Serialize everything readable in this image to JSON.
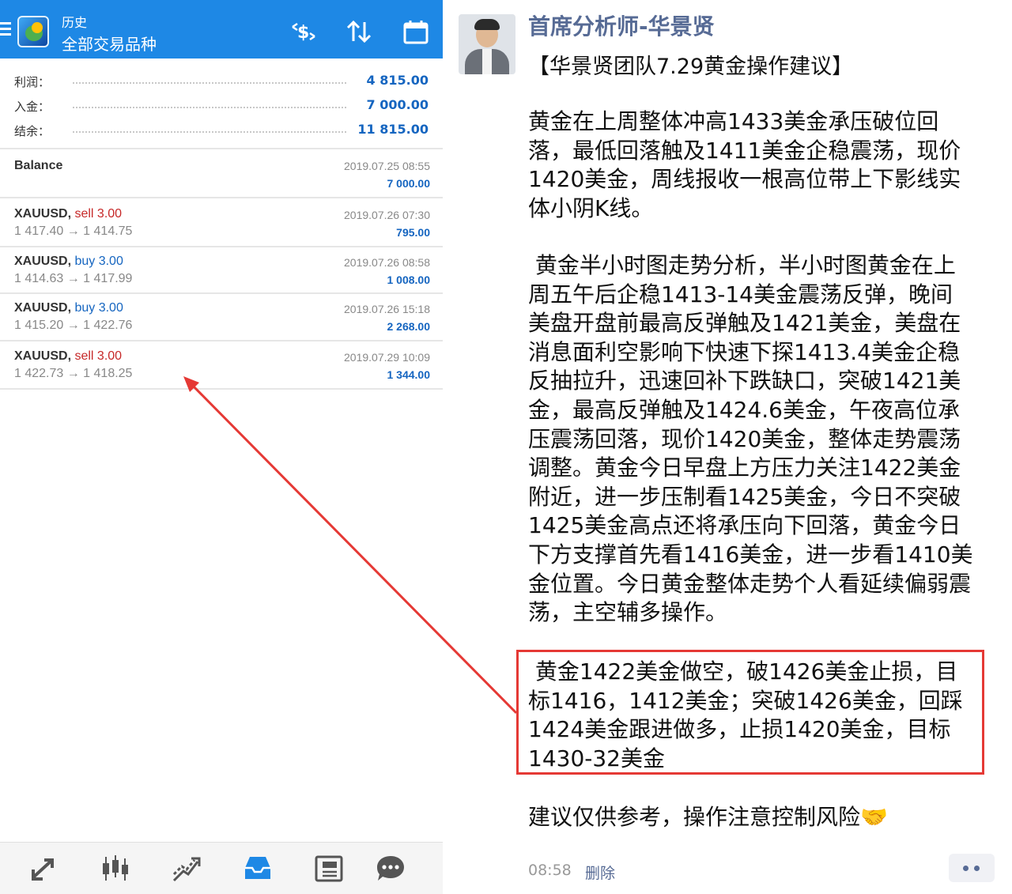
{
  "header": {
    "subtitle": "历史",
    "title": "全部交易品种",
    "icons": [
      "menu-icon",
      "metatrader-logo",
      "dollar-exchange-icon",
      "sort-icon",
      "calendar-icon"
    ]
  },
  "summary": [
    {
      "label": "利润：",
      "value": "4 815.00"
    },
    {
      "label": "入金：",
      "value": "7 000.00"
    },
    {
      "label": "结余：",
      "value": "11 815.00"
    }
  ],
  "balance": {
    "label": "Balance",
    "time": "2019.07.25 08:55",
    "amount": "7 000.00"
  },
  "deals": [
    {
      "symbol": "XAUUSD,",
      "direction": "sell 3.00",
      "dir_color": "#c62828",
      "prices": "1 417.40 → 1 414.75",
      "time": "2019.07.26 07:30",
      "profit": "795.00"
    },
    {
      "symbol": "XAUUSD,",
      "direction": "buy 3.00",
      "dir_color": "#1565c0",
      "prices": "1 414.63 → 1 417.99",
      "time": "2019.07.26 08:58",
      "profit": "1 008.00"
    },
    {
      "symbol": "XAUUSD,",
      "direction": "buy 3.00",
      "dir_color": "#1565c0",
      "prices": "1 415.20 → 1 422.76",
      "time": "2019.07.26 15:18",
      "profit": "2 268.00"
    },
    {
      "symbol": "XAUUSD,",
      "direction": "sell 3.00",
      "dir_color": "#c62828",
      "prices": "1 422.73 → 1 418.25",
      "time": "2019.07.29 10:09",
      "profit": "1 344.00"
    }
  ],
  "bottom_nav": [
    "quotes-icon",
    "chart-icon",
    "trade-icon",
    "history-icon",
    "news-icon",
    "chat-icon"
  ],
  "post": {
    "author": "首席分析师-华景贤",
    "title": "【华景贤团队7.29黄金操作建议】",
    "p1": "黄金在上周整体冲高1433美金承压破位回\n落，最低回落触及1411美金企稳震荡，现价\n1420美金，周线报收一根高位带上下影线实\n体小阴K线。",
    "p2": " 黄金半小时图走势分析，半小时图黄金在上\n周五午后企稳1413-14美金震荡反弹，晚间\n美盘开盘前最高反弹触及1421美金，美盘在\n消息面利空影响下快速下探1413.4美金企稳\n反抽拉升，迅速回补下跌缺口，突破1421美\n金，最高反弹触及1424.6美金，午夜高位承\n压震荡回落，现价1420美金，整体走势震荡\n调整。黄金今日早盘上方压力关注1422美金\n附近，进一步压制看1425美金，今日不突破\n1425美金高点还将承压向下回落，黄金今日\n下方支撑首先看1416美金，进一步看1410美\n金位置。今日黄金整体走势个人看延续偏弱震\n荡，主空辅多操作。",
    "p3": " 黄金1422美金做空，破1426美金止损，目\n标1416，1412美金；突破1426美金，回踩\n1424美金跟进做多，止损1420美金，目标\n1430-32美金",
    "p4": "建议仅供参考，操作注意控制风险🤝",
    "time": "08:58",
    "delete_label": "删除"
  },
  "colors": {
    "header": "#1e88e5",
    "link": "#576b95",
    "profit": "#1565c0",
    "sell": "#c62828",
    "annotation": "#e53935"
  }
}
